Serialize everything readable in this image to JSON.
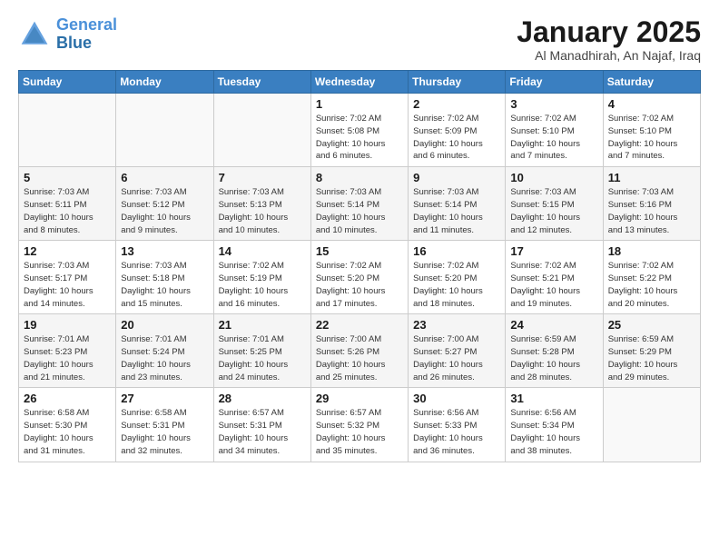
{
  "header": {
    "logo_line1": "General",
    "logo_line2": "Blue",
    "title": "January 2025",
    "subtitle": "Al Manadhirah, An Najaf, Iraq"
  },
  "weekdays": [
    "Sunday",
    "Monday",
    "Tuesday",
    "Wednesday",
    "Thursday",
    "Friday",
    "Saturday"
  ],
  "weeks": [
    [
      {
        "num": "",
        "info": ""
      },
      {
        "num": "",
        "info": ""
      },
      {
        "num": "",
        "info": ""
      },
      {
        "num": "1",
        "info": "Sunrise: 7:02 AM\nSunset: 5:08 PM\nDaylight: 10 hours\nand 6 minutes."
      },
      {
        "num": "2",
        "info": "Sunrise: 7:02 AM\nSunset: 5:09 PM\nDaylight: 10 hours\nand 6 minutes."
      },
      {
        "num": "3",
        "info": "Sunrise: 7:02 AM\nSunset: 5:10 PM\nDaylight: 10 hours\nand 7 minutes."
      },
      {
        "num": "4",
        "info": "Sunrise: 7:02 AM\nSunset: 5:10 PM\nDaylight: 10 hours\nand 7 minutes."
      }
    ],
    [
      {
        "num": "5",
        "info": "Sunrise: 7:03 AM\nSunset: 5:11 PM\nDaylight: 10 hours\nand 8 minutes."
      },
      {
        "num": "6",
        "info": "Sunrise: 7:03 AM\nSunset: 5:12 PM\nDaylight: 10 hours\nand 9 minutes."
      },
      {
        "num": "7",
        "info": "Sunrise: 7:03 AM\nSunset: 5:13 PM\nDaylight: 10 hours\nand 10 minutes."
      },
      {
        "num": "8",
        "info": "Sunrise: 7:03 AM\nSunset: 5:14 PM\nDaylight: 10 hours\nand 10 minutes."
      },
      {
        "num": "9",
        "info": "Sunrise: 7:03 AM\nSunset: 5:14 PM\nDaylight: 10 hours\nand 11 minutes."
      },
      {
        "num": "10",
        "info": "Sunrise: 7:03 AM\nSunset: 5:15 PM\nDaylight: 10 hours\nand 12 minutes."
      },
      {
        "num": "11",
        "info": "Sunrise: 7:03 AM\nSunset: 5:16 PM\nDaylight: 10 hours\nand 13 minutes."
      }
    ],
    [
      {
        "num": "12",
        "info": "Sunrise: 7:03 AM\nSunset: 5:17 PM\nDaylight: 10 hours\nand 14 minutes."
      },
      {
        "num": "13",
        "info": "Sunrise: 7:03 AM\nSunset: 5:18 PM\nDaylight: 10 hours\nand 15 minutes."
      },
      {
        "num": "14",
        "info": "Sunrise: 7:02 AM\nSunset: 5:19 PM\nDaylight: 10 hours\nand 16 minutes."
      },
      {
        "num": "15",
        "info": "Sunrise: 7:02 AM\nSunset: 5:20 PM\nDaylight: 10 hours\nand 17 minutes."
      },
      {
        "num": "16",
        "info": "Sunrise: 7:02 AM\nSunset: 5:20 PM\nDaylight: 10 hours\nand 18 minutes."
      },
      {
        "num": "17",
        "info": "Sunrise: 7:02 AM\nSunset: 5:21 PM\nDaylight: 10 hours\nand 19 minutes."
      },
      {
        "num": "18",
        "info": "Sunrise: 7:02 AM\nSunset: 5:22 PM\nDaylight: 10 hours\nand 20 minutes."
      }
    ],
    [
      {
        "num": "19",
        "info": "Sunrise: 7:01 AM\nSunset: 5:23 PM\nDaylight: 10 hours\nand 21 minutes."
      },
      {
        "num": "20",
        "info": "Sunrise: 7:01 AM\nSunset: 5:24 PM\nDaylight: 10 hours\nand 23 minutes."
      },
      {
        "num": "21",
        "info": "Sunrise: 7:01 AM\nSunset: 5:25 PM\nDaylight: 10 hours\nand 24 minutes."
      },
      {
        "num": "22",
        "info": "Sunrise: 7:00 AM\nSunset: 5:26 PM\nDaylight: 10 hours\nand 25 minutes."
      },
      {
        "num": "23",
        "info": "Sunrise: 7:00 AM\nSunset: 5:27 PM\nDaylight: 10 hours\nand 26 minutes."
      },
      {
        "num": "24",
        "info": "Sunrise: 6:59 AM\nSunset: 5:28 PM\nDaylight: 10 hours\nand 28 minutes."
      },
      {
        "num": "25",
        "info": "Sunrise: 6:59 AM\nSunset: 5:29 PM\nDaylight: 10 hours\nand 29 minutes."
      }
    ],
    [
      {
        "num": "26",
        "info": "Sunrise: 6:58 AM\nSunset: 5:30 PM\nDaylight: 10 hours\nand 31 minutes."
      },
      {
        "num": "27",
        "info": "Sunrise: 6:58 AM\nSunset: 5:31 PM\nDaylight: 10 hours\nand 32 minutes."
      },
      {
        "num": "28",
        "info": "Sunrise: 6:57 AM\nSunset: 5:31 PM\nDaylight: 10 hours\nand 34 minutes."
      },
      {
        "num": "29",
        "info": "Sunrise: 6:57 AM\nSunset: 5:32 PM\nDaylight: 10 hours\nand 35 minutes."
      },
      {
        "num": "30",
        "info": "Sunrise: 6:56 AM\nSunset: 5:33 PM\nDaylight: 10 hours\nand 36 minutes."
      },
      {
        "num": "31",
        "info": "Sunrise: 6:56 AM\nSunset: 5:34 PM\nDaylight: 10 hours\nand 38 minutes."
      },
      {
        "num": "",
        "info": ""
      }
    ]
  ]
}
